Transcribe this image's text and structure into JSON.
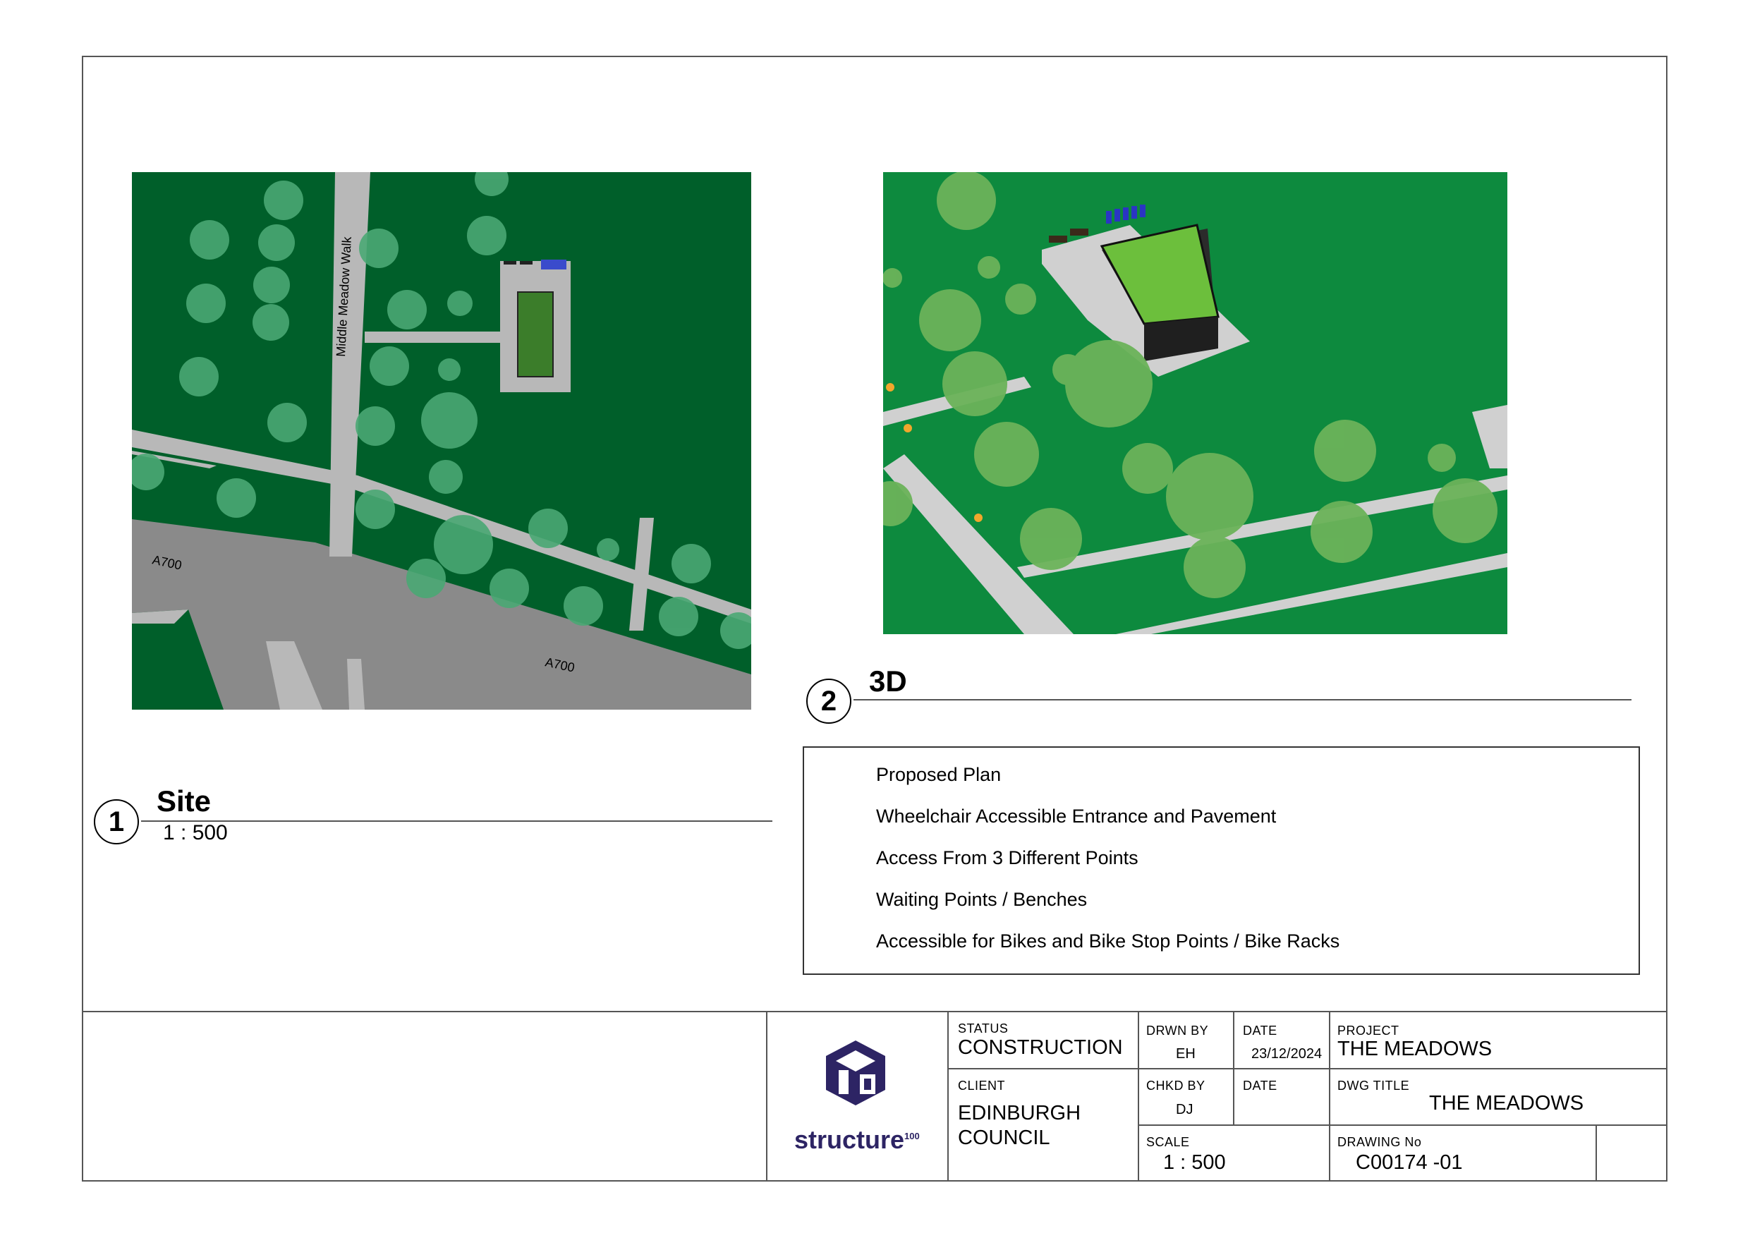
{
  "views": {
    "site": {
      "number": "1",
      "title": "Site",
      "scale": "1 : 500",
      "map_labels": {
        "walk": "Middle Meadow Walk",
        "road_a": "A700",
        "road_b": "A700"
      }
    },
    "three_d": {
      "number": "2",
      "title": "3D"
    }
  },
  "notes": [
    "Proposed Plan",
    "Wheelchair Accessible Entrance and Pavement",
    "Access From 3 Different Points",
    "Waiting Points / Benches",
    "Accessible for Bikes and Bike Stop Points / Bike Racks"
  ],
  "title_block": {
    "logo_text": "structure",
    "logo_superscript": "100",
    "status_label": "STATUS",
    "status_value": "CONSTRUCTION",
    "drawn_by_label": "DRWN BY",
    "drawn_by_value": "EH",
    "date_label": "DATE",
    "date_value": "23/12/2024",
    "project_label": "PROJECT",
    "project_value": "THE MEADOWS",
    "client_label": "CLIENT",
    "client_line1": "EDINBURGH",
    "client_line2": "COUNCIL",
    "checked_by_label": "CHKD BY",
    "checked_by_value": "DJ",
    "date2_label": "DATE",
    "dwg_title_label": "DWG TITLE",
    "dwg_title_value": "THE MEADOWS",
    "scale_label": "SCALE",
    "scale_value": "1 : 500",
    "drawing_no_label": "DRAWING No",
    "drawing_no_value": "C00174 -01"
  },
  "colors": {
    "grass_dark": "#005f2a",
    "grass_mid": "#0d8a3e",
    "path": "#b8b8b8",
    "road": "#8a8a8a",
    "roof": "#6cbf3c",
    "logo": "#2d2464"
  }
}
